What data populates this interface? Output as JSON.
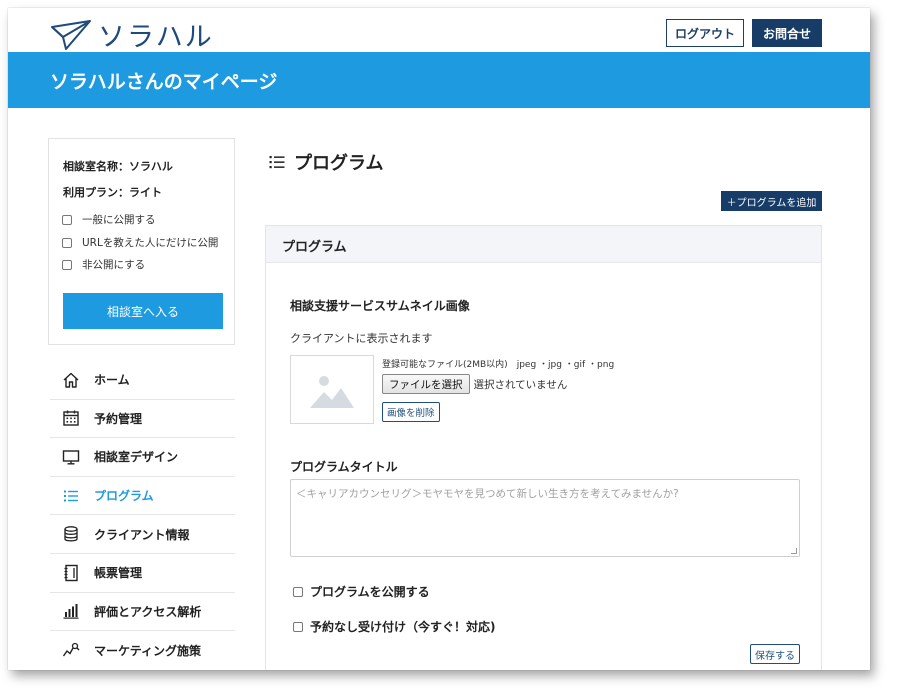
{
  "header": {
    "logo_text": "ソラハル",
    "logout_label": "ログアウト",
    "contact_label": "お問合せ"
  },
  "banner": {
    "title": "ソラハルさんのマイページ"
  },
  "sidebar": {
    "room_name": "相談室名称：ソラハル",
    "plan": "利用プラン：ライト",
    "visibility_options": [
      "一般に公開する",
      "URLを教えた人にだけに公開",
      "非公開にする"
    ],
    "enter_button": "相談室へ入る",
    "nav": [
      {
        "label": "ホーム",
        "icon": "home-icon"
      },
      {
        "label": "予約管理",
        "icon": "calendar-icon"
      },
      {
        "label": "相談室デザイン",
        "icon": "monitor-icon"
      },
      {
        "label": "プログラム",
        "icon": "list-icon",
        "active": true
      },
      {
        "label": "クライアント情報",
        "icon": "database-icon"
      },
      {
        "label": "帳票管理",
        "icon": "notebook-icon"
      },
      {
        "label": "評価とアクセス解析",
        "icon": "bar-chart-icon"
      },
      {
        "label": "マーケティング施策",
        "icon": "trend-icon"
      }
    ]
  },
  "main": {
    "page_title": "プログラム",
    "add_button": "＋プログラムを追加",
    "panel_title": "プログラム",
    "thumb_section_title": "相談支援サービスサムネイル画像",
    "thumb_section_desc": "クライアントに表示されます",
    "file_note": "登録可能なファイル(2MB以内)　jpeg ・jpg ・gif ・png",
    "file_button": "ファイルを選択",
    "file_status": "選択されていません",
    "delete_image_button": "画像を削除",
    "title_section": "プログラムタイトル",
    "title_placeholder": "＜キャリアカウンセリグ＞モヤモヤを見つめて新しい生き方を考えてみませんか?",
    "publish_check": "プログラムを公開する",
    "no_reservation_check": "予約なし受け付け（今すぐ！対応)",
    "save_button": "保存する"
  },
  "colors": {
    "brand_blue": "#1e9be0",
    "navy": "#163c67"
  }
}
